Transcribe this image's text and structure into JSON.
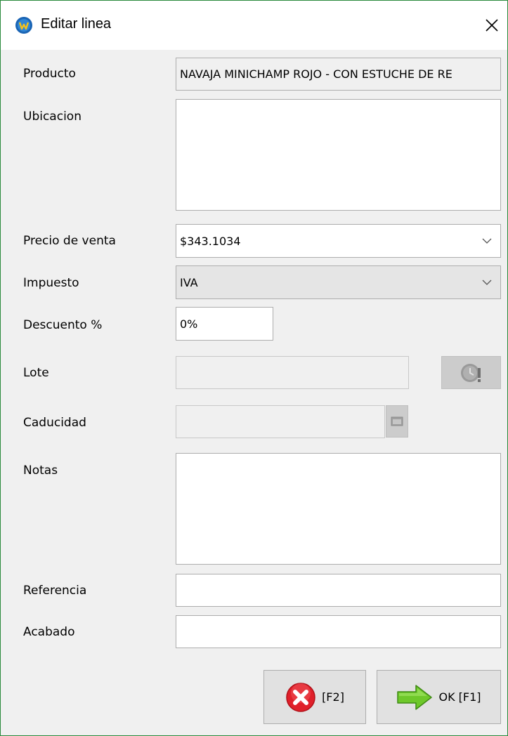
{
  "window": {
    "title": "Editar linea"
  },
  "form": {
    "producto": {
      "label": "Producto",
      "value": "NAVAJA MINICHAMP ROJO - CON ESTUCHE DE RE"
    },
    "ubicacion": {
      "label": "Ubicacion",
      "value": ""
    },
    "precio": {
      "label": "Precio de venta",
      "value": "$343.1034"
    },
    "impuesto": {
      "label": "Impuesto",
      "value": "IVA"
    },
    "descuento": {
      "label": "Descuento %",
      "value": "0%"
    },
    "lote": {
      "label": "Lote",
      "value": ""
    },
    "caducidad": {
      "label": "Caducidad",
      "value": ""
    },
    "notas": {
      "label": "Notas",
      "value": ""
    },
    "referencia": {
      "label": "Referencia",
      "value": ""
    },
    "acabado": {
      "label": "Acabado",
      "value": ""
    }
  },
  "buttons": {
    "cancel_label": "[F2]",
    "ok_label": "OK [F1]"
  },
  "icons": {
    "app": "app-logo-icon",
    "close": "close-icon",
    "chevron": "chevron-down-icon",
    "lote_lookup": "clock-icon",
    "calendar": "calendar-icon",
    "cancel": "cancel-x-icon",
    "ok": "green-arrow-icon"
  },
  "colors": {
    "window_border": "#2a8a3c",
    "cancel_red": "#e0202a",
    "ok_green": "#6ec82a"
  }
}
